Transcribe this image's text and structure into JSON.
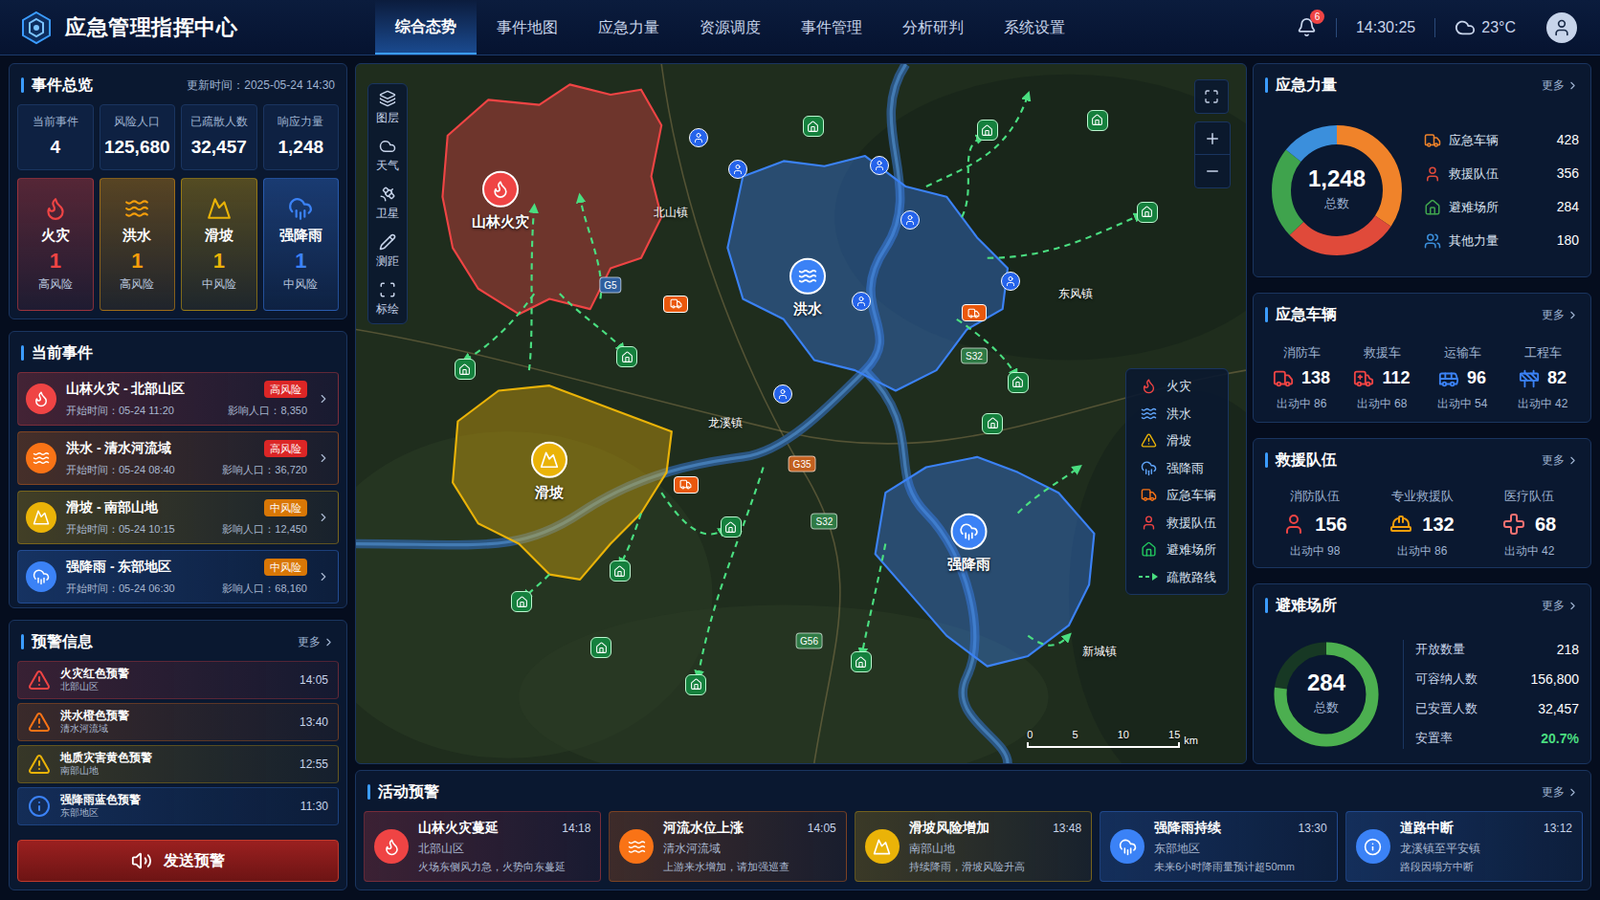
{
  "header": {
    "title": "应急管理指挥中心",
    "nav": [
      {
        "label": "综合态势",
        "selected": true
      },
      {
        "label": "事件地图",
        "selected": false
      },
      {
        "label": "应急力量",
        "selected": false
      },
      {
        "label": "资源调度",
        "selected": false
      },
      {
        "label": "事件管理",
        "selected": false
      },
      {
        "label": "分析研判",
        "selected": false
      },
      {
        "label": "系统设置",
        "selected": false
      }
    ],
    "notifications": "6",
    "time": "14:30:25",
    "weather": "23°C"
  },
  "overview": {
    "title": "事件总览",
    "updated": "更新时间：2025-05-24 14:30",
    "stats": [
      {
        "label": "当前事件",
        "value": "4"
      },
      {
        "label": "风险人口",
        "value": "125,680"
      },
      {
        "label": "已疏散人数",
        "value": "32,457"
      },
      {
        "label": "响应力量",
        "value": "1,248"
      }
    ],
    "types": [
      {
        "name": "火灾",
        "kind": "fire",
        "count": "1",
        "risk": "高风险",
        "color": "#ef4444"
      },
      {
        "name": "洪水",
        "kind": "flood",
        "count": "1",
        "risk": "高风险",
        "color": "#f59e0b"
      },
      {
        "name": "滑坡",
        "kind": "landslide",
        "count": "1",
        "risk": "中风险",
        "color": "#eab308"
      },
      {
        "name": "强降雨",
        "kind": "rain",
        "count": "1",
        "risk": "中风险",
        "color": "#3b82f6"
      }
    ]
  },
  "current_events": {
    "title": "当前事件",
    "items": [
      {
        "title": "山林火灾 - 北部山区",
        "kind": "fire",
        "risk": "高风险",
        "risk_color": "#dc2626",
        "start": "开始时间：05-24 11:20",
        "impact": "影响人口：8,350",
        "color": "#ef4444"
      },
      {
        "title": "洪水 - 清水河流域",
        "kind": "flood",
        "risk": "高风险",
        "risk_color": "#dc2626",
        "start": "开始时间：05-24 08:40",
        "impact": "影响人口：36,720",
        "color": "#f97316"
      },
      {
        "title": "滑坡 - 南部山地",
        "kind": "landslide",
        "risk": "中风险",
        "risk_color": "#d97706",
        "start": "开始时间：05-24 10:15",
        "impact": "影响人口：12,450",
        "color": "#eab308"
      },
      {
        "title": "强降雨 - 东部地区",
        "kind": "rain",
        "risk": "中风险",
        "risk_color": "#d97706",
        "start": "开始时间：05-24 06:30",
        "impact": "影响人口：68,160",
        "color": "#3b82f6"
      }
    ]
  },
  "warnings": {
    "title": "预警信息",
    "more": "更多",
    "items": [
      {
        "title": "火灾红色预警",
        "area": "北部山区",
        "time": "14:05",
        "kind": "triangle",
        "color": "#ef4444"
      },
      {
        "title": "洪水橙色预警",
        "area": "清水河流域",
        "time": "13:40",
        "kind": "triangle",
        "color": "#f97316"
      },
      {
        "title": "地质灾害黄色预警",
        "area": "南部山地",
        "time": "12:55",
        "kind": "triangle",
        "color": "#eab308"
      },
      {
        "title": "强降雨蓝色预警",
        "area": "东部地区",
        "time": "11:30",
        "kind": "info",
        "color": "#3b82f6"
      }
    ],
    "button": "发送预警"
  },
  "map": {
    "tools": [
      {
        "label": "图层",
        "kind": "layers"
      },
      {
        "label": "天气",
        "kind": "weather"
      },
      {
        "label": "卫星",
        "kind": "satellite"
      },
      {
        "label": "测距",
        "kind": "measure"
      },
      {
        "label": "标绘",
        "kind": "plot"
      }
    ],
    "hazards": [
      {
        "label": "山林火灾",
        "kind": "fire",
        "color": "#ef4444"
      },
      {
        "label": "洪水",
        "kind": "flood",
        "color": "#3b82f6"
      },
      {
        "label": "滑坡",
        "kind": "landslide",
        "color": "#eab308"
      },
      {
        "label": "强降雨",
        "kind": "rain",
        "color": "#3b82f6"
      }
    ],
    "towns": [
      "北山镇",
      "东风镇",
      "龙溪镇",
      "新城镇"
    ],
    "roads": [
      {
        "label": "G5",
        "color": "#2f5f9e"
      },
      {
        "label": "S32",
        "color": "#2f7a45"
      },
      {
        "label": "G35",
        "color": "#c2601f"
      },
      {
        "label": "S32",
        "color": "#2f7a45"
      },
      {
        "label": "G56",
        "color": "#2f7a45"
      }
    ],
    "legend": [
      {
        "label": "火灾",
        "kind": "fire"
      },
      {
        "label": "洪水",
        "kind": "flood"
      },
      {
        "label": "滑坡",
        "kind": "landslide"
      },
      {
        "label": "强降雨",
        "kind": "rain"
      },
      {
        "label": "应急车辆",
        "kind": "vehicle"
      },
      {
        "label": "救援队伍",
        "kind": "team"
      },
      {
        "label": "避难场所",
        "kind": "shelter"
      },
      {
        "label": "疏散路线",
        "kind": "route"
      }
    ],
    "scale": {
      "ticks": [
        "0",
        "5",
        "10",
        "15"
      ],
      "unit": "km"
    }
  },
  "activity": {
    "title": "活动预警",
    "more": "更多",
    "items": [
      {
        "title": "山林火灾蔓延",
        "time": "14:18",
        "area": "北部山区",
        "desc": "火场东侧风力急，火势向东蔓延",
        "kind": "fire",
        "color": "#ef4444"
      },
      {
        "title": "河流水位上涨",
        "time": "14:05",
        "area": "清水河流域",
        "desc": "上游来水增加，请加强巡查",
        "kind": "flood",
        "color": "#f97316"
      },
      {
        "title": "滑坡风险增加",
        "time": "13:48",
        "area": "南部山地",
        "desc": "持续降雨，滑坡风险升高",
        "kind": "landslide",
        "color": "#eab308"
      },
      {
        "title": "强降雨持续",
        "time": "13:30",
        "area": "东部地区",
        "desc": "未来6小时降雨量预计超50mm",
        "kind": "rain",
        "color": "#3b82f6"
      },
      {
        "title": "道路中断",
        "time": "13:12",
        "area": "龙溪镇至平安镇",
        "desc": "路段因塌方中断",
        "kind": "info",
        "color": "#3b82f6"
      }
    ]
  },
  "forces": {
    "title": "应急力量",
    "more": "更多",
    "total": "1,248",
    "total_label": "总数",
    "chart": [
      428,
      356,
      284,
      180
    ],
    "items": [
      {
        "label": "应急车辆",
        "value": "428",
        "kind": "vehicle",
        "color": "#f0832a"
      },
      {
        "label": "救援队伍",
        "value": "356",
        "kind": "team",
        "color": "#e04a3a"
      },
      {
        "label": "避难场所",
        "value": "284",
        "kind": "shelter",
        "color": "#3fa34d"
      },
      {
        "label": "其他力量",
        "value": "180",
        "kind": "other",
        "color": "#3b8fdc"
      }
    ]
  },
  "vehicles": {
    "title": "应急车辆",
    "more": "更多",
    "items": [
      {
        "label": "消防车",
        "value": "138",
        "active": "出动中 86",
        "kind": "fire-truck",
        "color": "#ef4444"
      },
      {
        "label": "救援车",
        "value": "112",
        "active": "出动中 68",
        "kind": "rescue",
        "color": "#ef4444"
      },
      {
        "label": "运输车",
        "value": "96",
        "active": "出动中 54",
        "kind": "transport",
        "color": "#3b82f6"
      },
      {
        "label": "工程车",
        "value": "82",
        "active": "出动中 42",
        "kind": "engineering",
        "color": "#3b82f6"
      }
    ]
  },
  "teams": {
    "title": "救援队伍",
    "more": "更多",
    "items": [
      {
        "label": "消防队伍",
        "value": "156",
        "active": "出动中 98",
        "kind": "fire",
        "color": "#ef4444"
      },
      {
        "label": "专业救援队",
        "value": "132",
        "active": "出动中 86",
        "kind": "rescue",
        "color": "#f59e0b"
      },
      {
        "label": "医疗队伍",
        "value": "68",
        "active": "出动中 42",
        "kind": "medical",
        "color": "#f87171"
      }
    ]
  },
  "shelters": {
    "title": "避难场所",
    "more": "更多",
    "total": "284",
    "total_label": "总数",
    "level": 0.77,
    "rows": [
      {
        "label": "开放数量",
        "value": "218",
        "highlight": false
      },
      {
        "label": "可容纳人数",
        "value": "156,800",
        "highlight": false
      },
      {
        "label": "已安置人数",
        "value": "32,457",
        "highlight": false
      },
      {
        "label": "安置率",
        "value": "20.7%",
        "highlight": true
      }
    ]
  }
}
